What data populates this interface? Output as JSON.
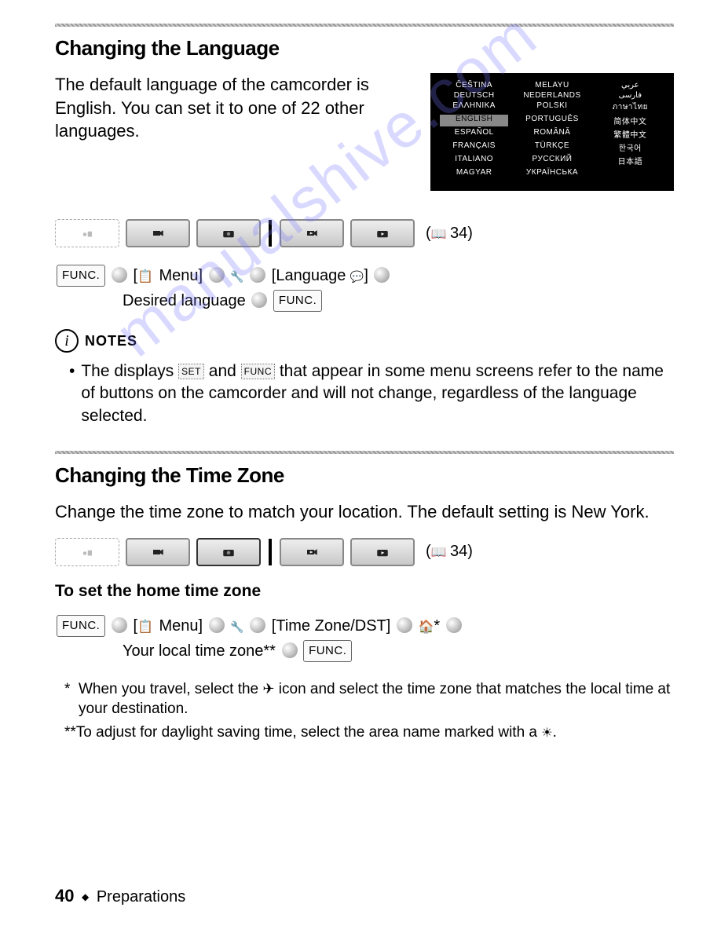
{
  "watermark": "manualshive.com",
  "section1": {
    "title": "Changing the Language",
    "intro": "The default language of the camcorder is English. You can set it to one of 22 other languages.",
    "langs_col1": [
      "ČEŠTINA",
      "DEUTSCH",
      "ΕΛΛΗΝΙΚΑ",
      "ENGLISH",
      "ESPAÑOL",
      "FRANÇAIS",
      "ITALIANO",
      "MAGYAR"
    ],
    "langs_col2": [
      "MELAYU",
      "NEDERLANDS",
      "POLSKI",
      "PORTUGUÊS",
      "ROMÂNĂ",
      "TÜRKÇE",
      "РУССКИЙ",
      "УКРАЇНСЬКА"
    ],
    "langs_col3": [
      "عربي",
      "فارسی",
      "ภาษาไทย",
      "简体中文",
      "繁體中文",
      "한국어",
      "日本語",
      ""
    ],
    "page_ref": "34",
    "func_label": "FUNC.",
    "menu_label": "Menu",
    "language_label": "Language",
    "desired_lang": "Desired language",
    "notes_label": "NOTES",
    "set_btn": "SET",
    "func_small": "FUNC",
    "notes_text": "that appear in some menu screens refer to the name of buttons on the camcorder and will not change, regardless of the language selected.",
    "notes_prefix": "The displays",
    "notes_and": "and"
  },
  "section2": {
    "title": "Changing the Time Zone",
    "intro": "Change the time zone to match your location. The default setting is New York.",
    "page_ref": "34",
    "sub_heading": "To set the home time zone",
    "func_label": "FUNC.",
    "menu_label": "Menu",
    "tz_label": "Time Zone/DST",
    "local_tz": "Your local time zone**",
    "foot1": "When you travel, select the",
    "foot1b": "icon and select the time zone that matches the local time at your destination.",
    "foot2": "To adjust for daylight saving time, select the area name marked with a",
    "foot2_end": "."
  },
  "footer": {
    "page_num": "40",
    "chapter": "Preparations"
  }
}
